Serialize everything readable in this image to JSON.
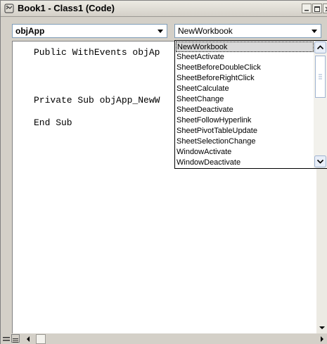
{
  "window": {
    "title": "Book1 - Class1 (Code)"
  },
  "object_dropdown": {
    "value": "objApp"
  },
  "procedure_dropdown": {
    "value": "NewWorkbook"
  },
  "code_lines": [
    "Public WithEvents objAp",
    "Private Sub objApp_NewW",
    "End Sub"
  ],
  "event_list": {
    "items": [
      "NewWorkbook",
      "SheetActivate",
      "SheetBeforeDoubleClick",
      "SheetBeforeRightClick",
      "SheetCalculate",
      "SheetChange",
      "SheetDeactivate",
      "SheetFollowHyperlink",
      "SheetPivotTableUpdate",
      "SheetSelectionChange",
      "WindowActivate",
      "WindowDeactivate"
    ],
    "selected": "NewWorkbook"
  },
  "icons": {
    "app": "vba-class-icon",
    "minimize": "minimize-icon",
    "maximize": "maximize-icon",
    "close": "close-icon",
    "dropdown": "chevron-down-icon"
  },
  "colors": {
    "face": "#d4d0c8",
    "selection": "#d9d9d9",
    "combo_border": "#7f9db9"
  }
}
